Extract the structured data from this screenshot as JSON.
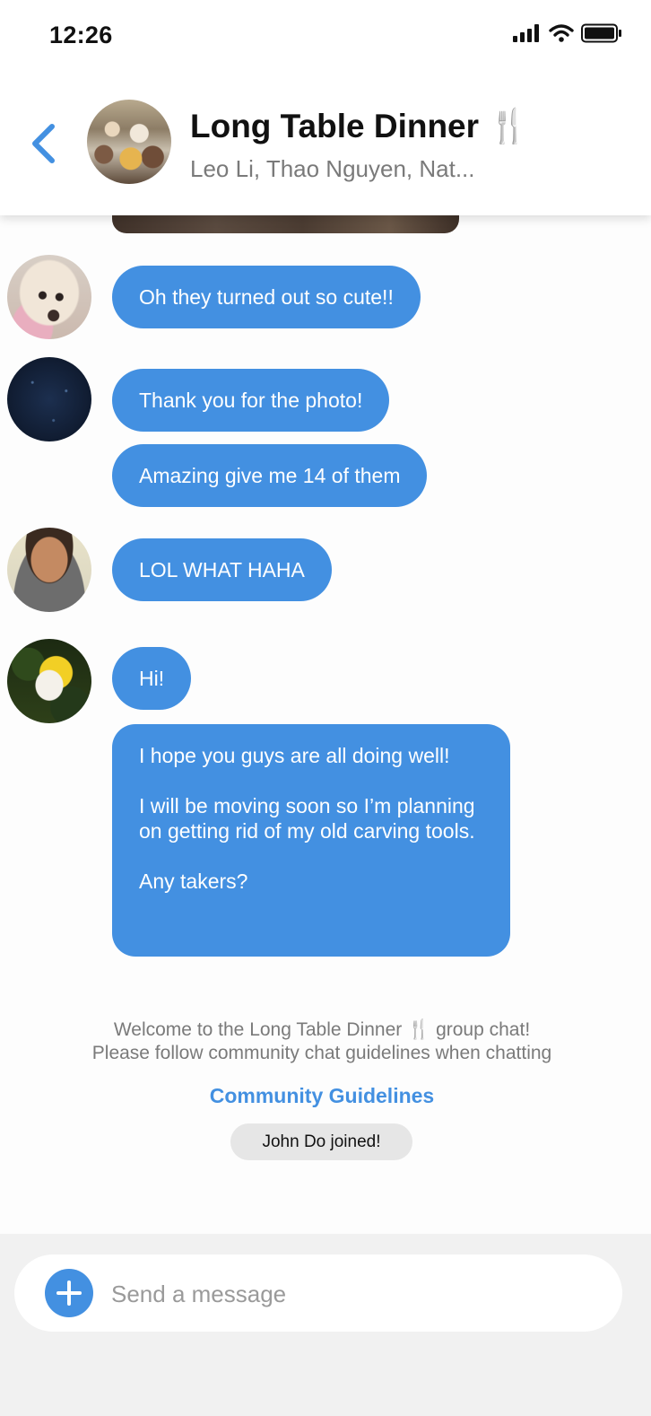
{
  "status_bar": {
    "time": "12:26",
    "icons": [
      "signal-icon",
      "wifi-icon",
      "battery-icon"
    ]
  },
  "header": {
    "title": "Long Table Dinner 🍴",
    "subtitle": "Leo Li, Thao Nguyen, Nat..."
  },
  "messages": [
    {
      "avatar": "dog-photo",
      "text": "Oh they turned out so cute!!"
    },
    {
      "avatar": "night-sky-photo",
      "text": "Thank you for the photo!"
    },
    {
      "avatar": "night-sky-photo",
      "text": "Amazing give me 14 of them"
    },
    {
      "avatar": "smiling-boy-photo",
      "text": "LOL WHAT HAHA"
    },
    {
      "avatar": "flower-photo",
      "text": "Hi!"
    },
    {
      "avatar": "flower-photo",
      "lines": [
        "I hope you guys are all doing well!",
        "I will be moving soon so I’m planning on getting rid of my old carving tools.",
        "Any takers?"
      ]
    }
  ],
  "system": {
    "welcome_line1": "Welcome to the Long Table Dinner 🍴 group chat!",
    "welcome_line2": "Please follow community chat guidelines when chatting",
    "guidelines_link": "Community Guidelines",
    "joined_notice": "John Do joined!"
  },
  "composer": {
    "placeholder": "Send a message"
  },
  "colors": {
    "accent": "#4390e1",
    "bubble_text": "#ffffff",
    "system_text": "#7a7a7a",
    "composer_bg": "#f1f1f1"
  }
}
